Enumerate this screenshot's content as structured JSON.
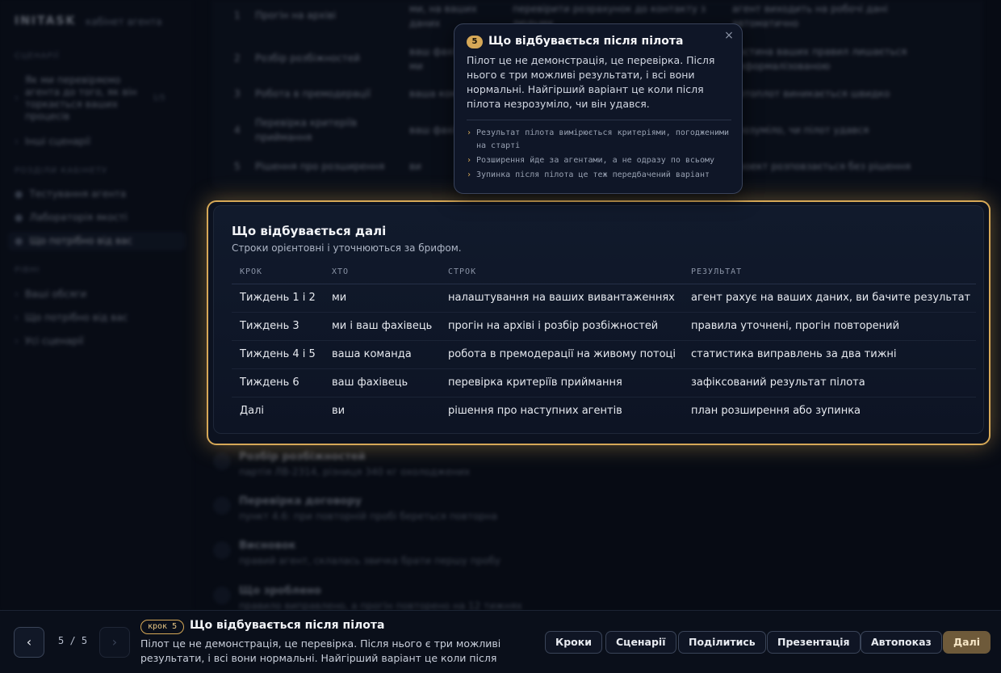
{
  "sidebar": {
    "brand": "INITASK",
    "brand_sub": "кабінет агента",
    "section1": "СЦЕНАРІЇ",
    "items1": [
      {
        "bullet": "›",
        "label": "Як ми перевіряємо агента до того, як він торкається ваших процесів",
        "count": "1/5"
      },
      {
        "bullet": "›",
        "label": "Інші сценарії"
      }
    ],
    "section2": "РОЗДІЛИ КАБІНЕТУ",
    "items2": [
      {
        "bullet": "●",
        "label": "Тестування агента"
      },
      {
        "bullet": "●",
        "label": "Лабораторія якості"
      },
      {
        "bullet": "●",
        "label": "Що потрібно від вас"
      }
    ],
    "section3": "РІВНІ",
    "items3": [
      {
        "bullet": "›",
        "label": "Ваші обсяги"
      },
      {
        "bullet": "›",
        "label": "Що потрібно від вас"
      },
      {
        "bullet": "›",
        "label": "Усі сценарії"
      }
    ]
  },
  "bg_table": {
    "rows": [
      [
        "1",
        "Прогін на архіві",
        "ми, на ваших даних",
        "перевірити розрахунок до контакту з людьми",
        "агент виходить на робочі дані автоматично"
      ],
      [
        "2",
        "Розбір розбіжностей",
        "ваш фахівець і ми",
        "",
        "частина ваших правил лишається неформалізованою"
      ],
      [
        "3",
        "Робота в премодерації",
        "ваша команда",
        "",
        "потоплот виникається швидко"
      ],
      [
        "4",
        "Перевірка критеріїв приймання",
        "ваш фахівець",
        "",
        "зрозуміло, чи пілот удався"
      ],
      [
        "5",
        "Рішення про розширення",
        "ви",
        "",
        "проект розповзається без рішення"
      ]
    ]
  },
  "bg_steps": [
    {
      "title": "Розбір розбіжностей",
      "desc": "партія ЛВ-2314, різниця 340 кг охолоджених"
    },
    {
      "title": "Перевірка договору",
      "desc": "пункт 4.6: при повторній пробі береться повторна"
    },
    {
      "title": "Висновок",
      "desc": "правий агент, склалась звичка брати першу пробу"
    },
    {
      "title": "Що зроблено",
      "desc": "правило виправлено, а прогін повторено на 12 тижнях"
    }
  ],
  "card": {
    "title": "Що відбувається далі",
    "subtitle": "Строки орієнтовні і уточнюються за брифом.",
    "columns": [
      "КРОК",
      "ХТО",
      "СТРОК",
      "РЕЗУЛЬТАТ"
    ],
    "rows": [
      [
        "Тиждень 1 і 2",
        "ми",
        "налаштування на ваших вивантаженнях",
        "агент рахує на ваших даних, ви бачите результат"
      ],
      [
        "Тиждень 3",
        "ми і ваш фахівець",
        "прогін на архіві і розбір розбіжностей",
        "правила уточнені, прогін повторений"
      ],
      [
        "Тиждень 4 і 5",
        "ваша команда",
        "робота в премодерації на живому потоці",
        "статистика виправлень за два тижні"
      ],
      [
        "Тиждень 6",
        "ваш фахівець",
        "перевірка критеріїв приймання",
        "зафіксований результат пілота"
      ],
      [
        "Далі",
        "ви",
        "рішення про наступних агентів",
        "план розширення або зупинка"
      ]
    ]
  },
  "tooltip": {
    "number": "5",
    "title": "Що відбувається після пілота",
    "close": "×",
    "body": "Пілот це не демонстрація, це перевірка. Після нього є три можливі результати, і всі вони нормальні. Найгірший варіант це коли після пілота незрозуміло, чи він удався.",
    "points": [
      "Результат пілота вимірюється критеріями, погодженими на старті",
      "Розширення йде за агентами, а не одразу по всьому",
      "Зупинка після пілота це теж передбачений варіант"
    ]
  },
  "footer": {
    "prev": "‹",
    "next": "›",
    "counter": "5 / 5",
    "badge": "крок 5",
    "title": "Що відбувається після пілота",
    "description": "Пілот це не демонстрація, це перевірка. Після нього є три можливі результати, і всі вони нормальні. Найгірший варіант це коли після пілота…",
    "buttons": {
      "steps": "Кроки",
      "scenarios": "Сценарії",
      "share": "Поділитись",
      "presentation": "Презентація",
      "autoplay": "Автопоказ",
      "next": "Далі"
    }
  },
  "colors": {
    "accent": "#d6a857",
    "background": "#070b14",
    "card": "#111a2c"
  }
}
